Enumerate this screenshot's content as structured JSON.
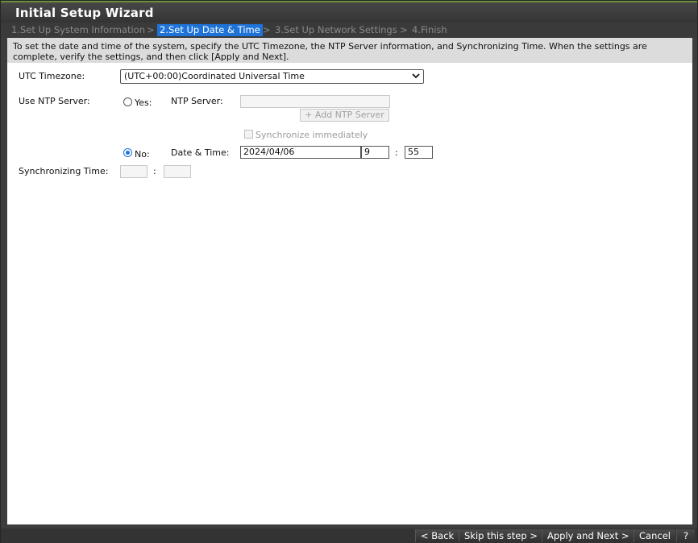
{
  "window": {
    "title": "Initial Setup Wizard"
  },
  "steps": [
    {
      "label": "1.Set Up System Information"
    },
    {
      "label": "2.Set Up Date & Time"
    },
    {
      "label": "3.Set Up Network Settings"
    },
    {
      "label": "4.Finish"
    }
  ],
  "step_separator": ">",
  "description": "To set the date and time of the system, specify the UTC Timezone, the NTP Server information, and Synchronizing Time. When the settings are complete, verify the settings, and then click [Apply and Next].",
  "form": {
    "utc_timezone_label": "UTC Timezone:",
    "utc_timezone_value": "(UTC+00:00)Coordinated Universal Time",
    "use_ntp_label": "Use NTP Server:",
    "yes_label": "Yes:",
    "ntp_server_label": "NTP Server:",
    "ntp_server_value": "",
    "add_ntp_button": "+ Add NTP Server",
    "sync_immediately_label": "Synchronize immediately",
    "no_label": "No:",
    "date_time_label": "Date & Time:",
    "date_value": "2024/04/06",
    "hour_value": "9",
    "time_colon": ":",
    "minute_value": "55",
    "sync_time_label": "Synchronizing Time:",
    "sync_hour_value": "",
    "sync_minute_value": ""
  },
  "footer": {
    "back": "< Back",
    "skip": "Skip this step >",
    "apply_next": "Apply and Next >",
    "cancel": "Cancel",
    "help": "?"
  },
  "colors": {
    "accent": "#1e73d8",
    "titlebar": "#3a3a3a",
    "description_bg": "#dcdcdc"
  }
}
